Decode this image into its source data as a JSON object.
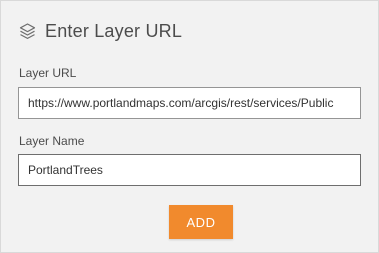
{
  "header": {
    "icon": "layers-icon",
    "title": "Enter Layer URL"
  },
  "form": {
    "url_label": "Layer URL",
    "url_value": "https://www.portlandmaps.com/arcgis/rest/services/Public",
    "name_label": "Layer Name",
    "name_value": "PortlandTrees",
    "add_label": "ADD"
  },
  "colors": {
    "accent": "#f18a2d",
    "panel_bg": "#f2f2f2",
    "text": "#4c4c4c"
  }
}
